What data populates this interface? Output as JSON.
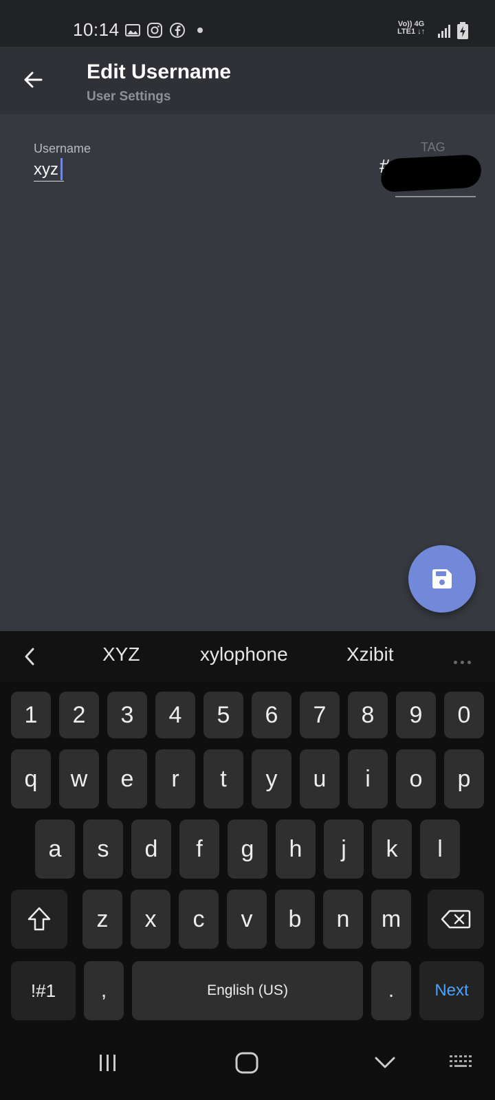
{
  "status_bar": {
    "time": "10:14",
    "net_top": "Vo)) 4G",
    "net_bottom": "LTE1 ↓↑"
  },
  "app_bar": {
    "title": "Edit Username",
    "subtitle": "User Settings"
  },
  "form": {
    "username_label": "Username",
    "username_value": "xyz",
    "tag_label": "TAG",
    "tag_prefix": "#"
  },
  "colors": {
    "accent": "#7289da",
    "background": "#36393f",
    "app_bar": "#2f3136",
    "next_key": "#4aa3ff"
  },
  "keyboard": {
    "suggestions": [
      "XYZ",
      "xylophone",
      "Xzibit"
    ],
    "row_numbers": [
      "1",
      "2",
      "3",
      "4",
      "5",
      "6",
      "7",
      "8",
      "9",
      "0"
    ],
    "row_top": [
      "q",
      "w",
      "e",
      "r",
      "t",
      "y",
      "u",
      "i",
      "o",
      "p"
    ],
    "row_middle": [
      "a",
      "s",
      "d",
      "f",
      "g",
      "h",
      "j",
      "k",
      "l"
    ],
    "row_bottom": [
      "z",
      "x",
      "c",
      "v",
      "b",
      "n",
      "m"
    ],
    "symbols_label": "!#1",
    "comma_label": ",",
    "space_label": "English (US)",
    "period_label": ".",
    "next_label": "Next"
  },
  "icons": {
    "back": "arrow-left-icon",
    "save": "floppy-disk-icon",
    "shift": "shift-arrow-icon",
    "backspace": "backspace-icon"
  }
}
